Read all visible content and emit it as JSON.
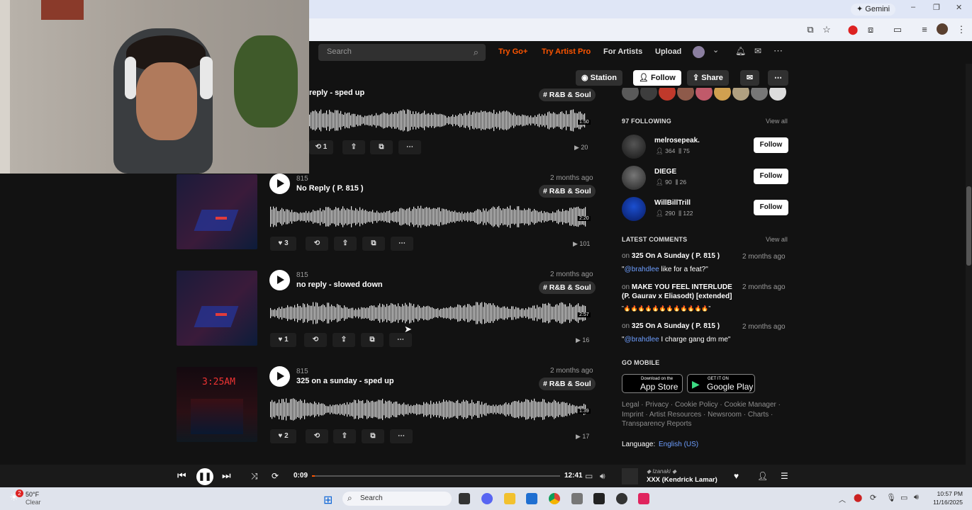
{
  "browser": {
    "gemini_label": "Gemini",
    "win_min": "–",
    "win_max": "❐",
    "win_close": "✕"
  },
  "nav": {
    "search_placeholder": "Search",
    "try_go": "Try Go+",
    "try_artist_pro": "Try Artist Pro",
    "for_artists": "For Artists",
    "upload": "Upload"
  },
  "profile_actions": {
    "station": "Station",
    "follow": "Follow",
    "share": "Share"
  },
  "tracks": [
    {
      "name": "reply - sped up",
      "tag": "# R&B & Soul",
      "reposts": "1",
      "plays": "20",
      "duration": "1:50"
    },
    {
      "artist": "815",
      "name": "No Reply ( P. 815 )",
      "ago": "2 months ago",
      "tag": "# R&B & Soul",
      "likes": "3",
      "plays": "101",
      "duration": "2:20"
    },
    {
      "artist": "815",
      "name": "no reply - slowed down",
      "ago": "2 months ago",
      "tag": "# R&B & Soul",
      "likes": "1",
      "plays": "16",
      "duration": "2:57"
    },
    {
      "artist": "815",
      "name": "325 on a sunday - sped up",
      "ago": "2 months ago",
      "tag": "# R&B & Soul",
      "likes": "2",
      "plays": "17",
      "duration": "1:39"
    }
  ],
  "following": {
    "header": "97 FOLLOWING",
    "view_all": "View all",
    "users": [
      {
        "name": "melrosepeak.",
        "followers": "364",
        "tracks": "75",
        "button": "Follow"
      },
      {
        "name": "DIEGE",
        "followers": "90",
        "tracks": "26",
        "button": "Follow"
      },
      {
        "name": "WillBillTrill",
        "followers": "290",
        "tracks": "122",
        "button": "Follow"
      }
    ]
  },
  "comments": {
    "header": "LATEST COMMENTS",
    "view_all": "View all",
    "items": [
      {
        "on": "on",
        "track": "325 On A Sunday ( P. 815 )",
        "ago": "2 months ago",
        "quote_open": "\"",
        "mention": "@brahdlee",
        "text": " like for a feat?\""
      },
      {
        "on": "on",
        "track": "MAKE YOU FEEL INTERLUDE (P. Gaurav x Eliasodt) [extended]",
        "ago": "2 months ago",
        "text": "\"🔥🔥🔥🔥🔥🔥🔥🔥🔥🔥🔥🔥\""
      },
      {
        "on": "on",
        "track": "325 On A Sunday ( P. 815 )",
        "ago": "2 months ago",
        "quote_open": "\"",
        "mention": "@brahdlee",
        "text": " I charge gang dm me\""
      }
    ]
  },
  "mobile": {
    "header": "GO MOBILE",
    "appstore_small": "Download on the",
    "appstore": "App Store",
    "google_small": "GET IT ON",
    "google": "Google Play"
  },
  "footer": {
    "line1": "Legal · Privacy · Cookie Policy · Cookie Manager ·",
    "line2": "Imprint · Artist Resources · Newsroom · Charts ·",
    "line3": "Transparency Reports",
    "language_label": "Language:",
    "language_value": "English (US)"
  },
  "player": {
    "elapsed": "0:09",
    "total": "12:41",
    "progress": 0.012,
    "track_artist": "Izanaki",
    "track_title": "XXX (Kendrick Lamar)"
  },
  "taskbar": {
    "weather_temp": "50°F",
    "weather_desc": "Clear",
    "weather_badge": "2",
    "search": "Search",
    "time": "10:57 PM",
    "date": "11/16/2025"
  },
  "colors": {
    "accent": "#ff5500",
    "link": "#6d9eff"
  }
}
